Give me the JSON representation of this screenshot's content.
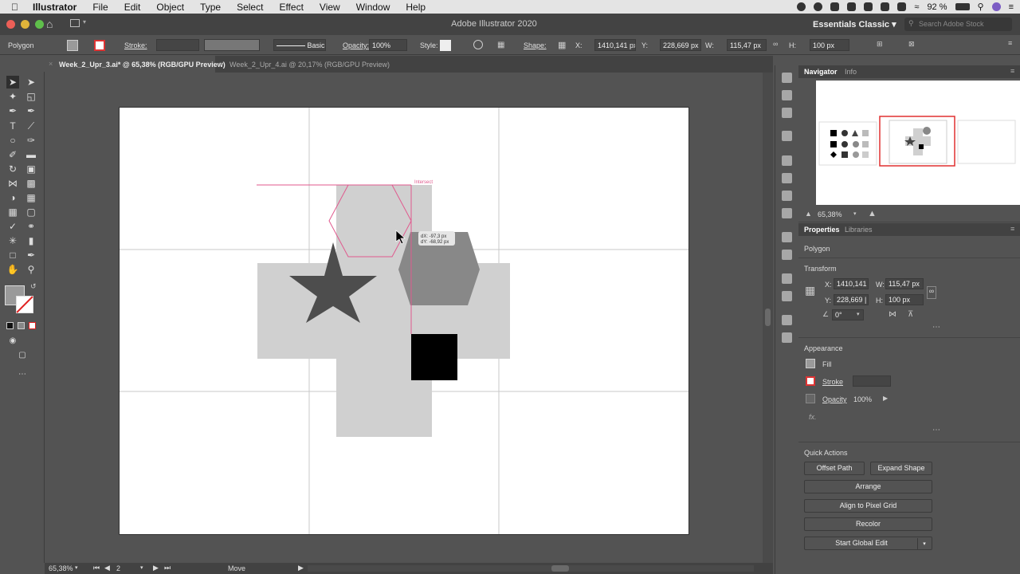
{
  "menubar": {
    "app_name": "Illustrator",
    "items": [
      "File",
      "Edit",
      "Object",
      "Type",
      "Select",
      "Effect",
      "View",
      "Window",
      "Help"
    ],
    "battery": "92 %"
  },
  "appbar": {
    "title": "Adobe Illustrator 2020",
    "workspace": "Essentials Classic",
    "search_placeholder": "Search Adobe Stock"
  },
  "controlbar": {
    "selection_type": "Polygon",
    "stroke_label": "Stroke:",
    "brush_label": "Basic",
    "opacity_label": "Opacity:",
    "opacity_value": "100%",
    "style_label": "Style:",
    "shape_label": "Shape:",
    "x_label": "X:",
    "x_value": "1410,141 px",
    "y_label": "Y:",
    "y_value": "228,669 px",
    "w_label": "W:",
    "w_value": "115,47 px",
    "h_label": "H:",
    "h_value": "100 px"
  },
  "tabs": [
    {
      "label": "Week_2_Upr_3.ai* @ 65,38% (RGB/GPU Preview)",
      "active": true
    },
    {
      "label": "Week_2_Upr_4.ai @ 20,17% (RGB/GPU Preview)",
      "active": false
    }
  ],
  "canvas": {
    "smart_guide_label": "Intersect",
    "move_tooltip_dx": "dX: -97,3 px",
    "move_tooltip_dy": "dY: -68,92 px"
  },
  "statusbar": {
    "zoom": "65,38%",
    "artboard_number": "2",
    "tool_status": "Move"
  },
  "navigator": {
    "tab_navigator": "Navigator",
    "tab_info": "Info",
    "zoom": "65,38%"
  },
  "properties": {
    "tab_properties": "Properties",
    "tab_libraries": "Libraries",
    "object_type": "Polygon",
    "transform_title": "Transform",
    "x_label": "X:",
    "x_value": "1410,141",
    "y_label": "Y:",
    "y_value": "228,669 |",
    "w_label": "W:",
    "w_value": "115,47 px",
    "h_label": "H:",
    "h_value": "100 px",
    "rotate_value": "0°",
    "appearance_title": "Appearance",
    "fill_label": "Fill",
    "stroke_label": "Stroke",
    "opacity_label": "Opacity",
    "opacity_value": "100%",
    "fx_label": "fx.",
    "quick_actions_title": "Quick Actions",
    "buttons": {
      "offset_path": "Offset Path",
      "expand_shape": "Expand Shape",
      "arrange": "Arrange",
      "align_pixel_grid": "Align to Pixel Grid",
      "recolor": "Recolor",
      "start_global_edit": "Start Global Edit"
    }
  },
  "colors": {
    "accent_selection": "#e05a8e",
    "shape_light": "#d0d0d0",
    "shape_mid": "#888888",
    "shape_dark": "#4d4d4d",
    "panel_bg": "#535353"
  }
}
